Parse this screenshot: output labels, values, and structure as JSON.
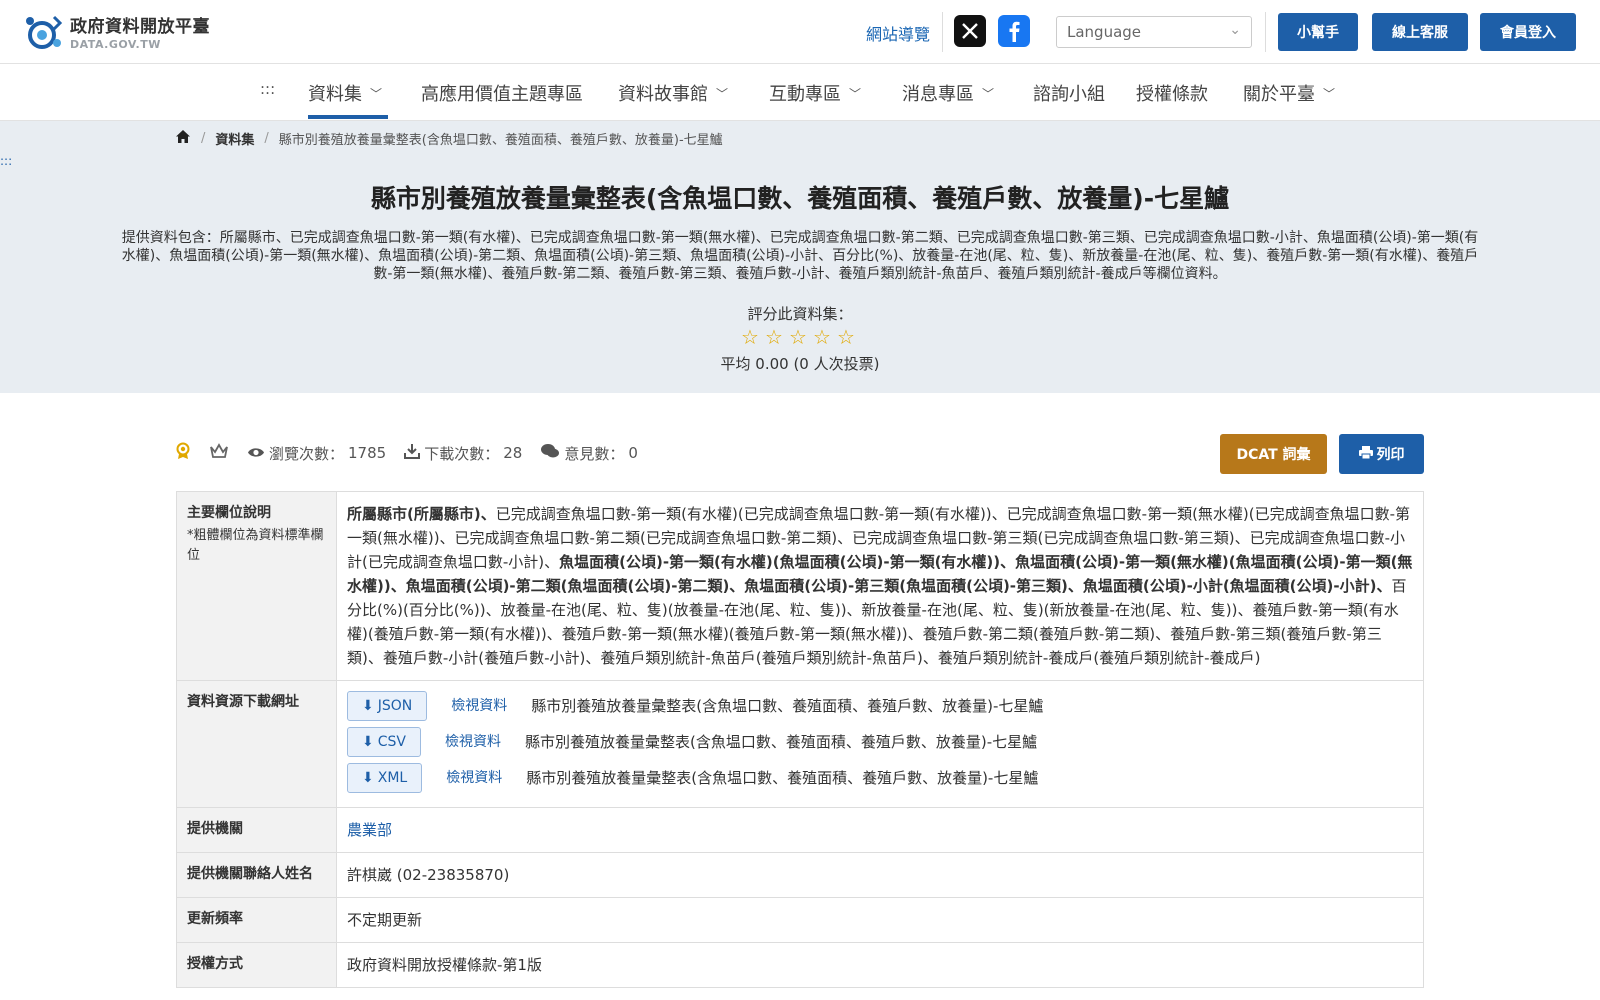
{
  "header": {
    "logo_title": "政府資料開放平臺",
    "logo_sub": "DATA.GOV.TW",
    "site_nav": "網站導覽",
    "language_placeholder": "Language",
    "buttons": [
      "小幫手",
      "線上客服",
      "會員登入"
    ]
  },
  "nav": {
    "skip": ":::",
    "items": [
      "資料集",
      "高應用價值主題專區",
      "資料故事館",
      "互動專區",
      "消息專區",
      "諮詢小組",
      "授權條款",
      "關於平臺"
    ]
  },
  "breadcrumb": {
    "items": [
      "資料集",
      "縣市別養殖放養量彙整表(含魚塭口數、養殖面積、養殖戶數、放養量)-七星鱸"
    ],
    "dots": ":::"
  },
  "dataset": {
    "title": "縣市別養殖放養量彙整表(含魚塭口數、養殖面積、養殖戶數、放養量)-七星鱸",
    "description": "提供資料包含：所屬縣市、已完成調查魚塭口數-第一類(有水權)、已完成調查魚塭口數-第一類(無水權)、已完成調查魚塭口數-第二類、已完成調查魚塭口數-第三類、已完成調查魚塭口數-小計、魚塭面積(公頃)-第一類(有水權)、魚塭面積(公頃)-第一類(無水權)、魚塭面積(公頃)-第二類、魚塭面積(公頃)-第三類、魚塭面積(公頃)-小計、百分比(%)、放養量-在池(尾、粒、隻)、新放養量-在池(尾、粒、隻)、養殖戶數-第一類(有水權)、養殖戶數-第一類(無水權)、養殖戶數-第二類、養殖戶數-第三類、養殖戶數-小計、養殖戶類別統計-魚苗戶、養殖戶類別統計-養成戶等欄位資料。",
    "rate_label": "評分此資料集：",
    "avg_text": "平均 0.00 (0 人次投票)"
  },
  "stats": {
    "views_label": "瀏覽次數：",
    "views": "1785",
    "downloads_label": "下載次數：",
    "downloads": "28",
    "comments_label": "意見數：",
    "comments": "0",
    "dcat_label": "DCAT 詞彙",
    "print_label": "列印"
  },
  "table": {
    "main_fields_label": "主要欄位說明",
    "main_fields_note": "*粗體欄位為資料標準欄位",
    "main_fields_parts": [
      {
        "b": true,
        "t": "所屬縣市(所屬縣市)、"
      },
      {
        "b": false,
        "t": "已完成調查魚塭口數-第一類(有水權)(已完成調查魚塭口數-第一類(有水權))、已完成調查魚塭口數-第一類(無水權)(已完成調查魚塭口數-第一類(無水權))、已完成調查魚塭口數-第二類(已完成調查魚塭口數-第二類)、已完成調查魚塭口數-第三類(已完成調查魚塭口數-第三類)、已完成調查魚塭口數-小計(已完成調查魚塭口數-小計)、"
      },
      {
        "b": true,
        "t": "魚塭面積(公頃)-第一類(有水權)(魚塭面積(公頃)-第一類(有水權))、魚塭面積(公頃)-第一類(無水權)(魚塭面積(公頃)-第一類(無水權))、魚塭面積(公頃)-第二類(魚塭面積(公頃)-第二類)、魚塭面積(公頃)-第三類(魚塭面積(公頃)-第三類)、魚塭面積(公頃)-小計(魚塭面積(公頃)-小計)、"
      },
      {
        "b": false,
        "t": "百分比(%)(百分比(%))、放養量-在池(尾、粒、隻)(放養量-在池(尾、粒、隻))、新放養量-在池(尾、粒、隻)(新放養量-在池(尾、粒、隻))、養殖戶數-第一類(有水權)(養殖戶數-第一類(有水權))、養殖戶數-第一類(無水權)(養殖戶數-第一類(無水權))、養殖戶數-第二類(養殖戶數-第二類)、養殖戶數-第三類(養殖戶數-第三類)、養殖戶數-小計(養殖戶數-小計)、養殖戶類別統計-魚苗戶(養殖戶類別統計-魚苗戶)、養殖戶類別統計-養成戶(養殖戶類別統計-養成戶)"
      }
    ],
    "resource_label": "資料資源下載網址",
    "resources": [
      {
        "format": "JSON",
        "view": "檢視資料",
        "name": "縣市別養殖放養量彙整表(含魚塭口數、養殖面積、養殖戶數、放養量)-七星鱸"
      },
      {
        "format": "CSV",
        "view": "檢視資料",
        "name": "縣市別養殖放養量彙整表(含魚塭口數、養殖面積、養殖戶數、放養量)-七星鱸"
      },
      {
        "format": "XML",
        "view": "檢視資料",
        "name": "縣市別養殖放養量彙整表(含魚塭口數、養殖面積、養殖戶數、放養量)-七星鱸"
      }
    ],
    "provider_label": "提供機關",
    "provider": "農業部",
    "contact_label": "提供機關聯絡人姓名",
    "contact": "許棋崴 (02-23835870)",
    "freq_label": "更新頻率",
    "freq": "不定期更新",
    "license_label": "授權方式",
    "license": "政府資料開放授權條款-第1版"
  },
  "colors": {
    "primary": "#1e5fa8",
    "dcat": "#b7781a",
    "hero_bg": "#e8edf2",
    "star": "#e0a800"
  }
}
